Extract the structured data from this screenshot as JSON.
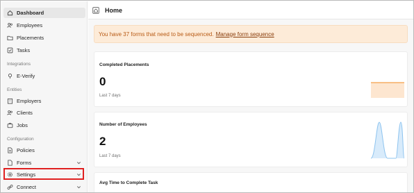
{
  "sidebar": {
    "items": [
      {
        "label": "Dashboard",
        "icon": "home-icon"
      },
      {
        "label": "Employees",
        "icon": "users-icon"
      },
      {
        "label": "Placements",
        "icon": "folder-icon"
      },
      {
        "label": "Tasks",
        "icon": "checkbox-icon"
      }
    ],
    "integrations_label": "Integrations",
    "integrations_items": [
      {
        "label": "E-Verify",
        "icon": "pin-icon"
      }
    ],
    "entities_label": "Entities",
    "entities_items": [
      {
        "label": "Employers",
        "icon": "building-icon"
      },
      {
        "label": "Clients",
        "icon": "users-icon"
      },
      {
        "label": "Jobs",
        "icon": "briefcase-icon"
      }
    ],
    "configuration_label": "Configuration",
    "configuration_items": [
      {
        "label": "Policies",
        "icon": "document-icon"
      },
      {
        "label": "Forms",
        "icon": "form-icon"
      },
      {
        "label": "Settings",
        "icon": "gear-icon"
      },
      {
        "label": "Connect",
        "icon": "link-icon"
      }
    ]
  },
  "header": {
    "title": "Home",
    "icon": "home-icon"
  },
  "alert": {
    "text": "You have 37 forms that need to be sequenced.",
    "link": "Manage form sequence",
    "color": "#b85a14"
  },
  "cards": [
    {
      "title": "Completed Placements",
      "value": "0",
      "sub": "Last 7 days",
      "accent": "#f5a04a"
    },
    {
      "title": "Number of Employees",
      "value": "2",
      "sub": "Last 7 days",
      "accent": "#8ec4ef"
    },
    {
      "title": "Avg Time to Complete Task"
    }
  ],
  "highlight_color": "#e02020"
}
